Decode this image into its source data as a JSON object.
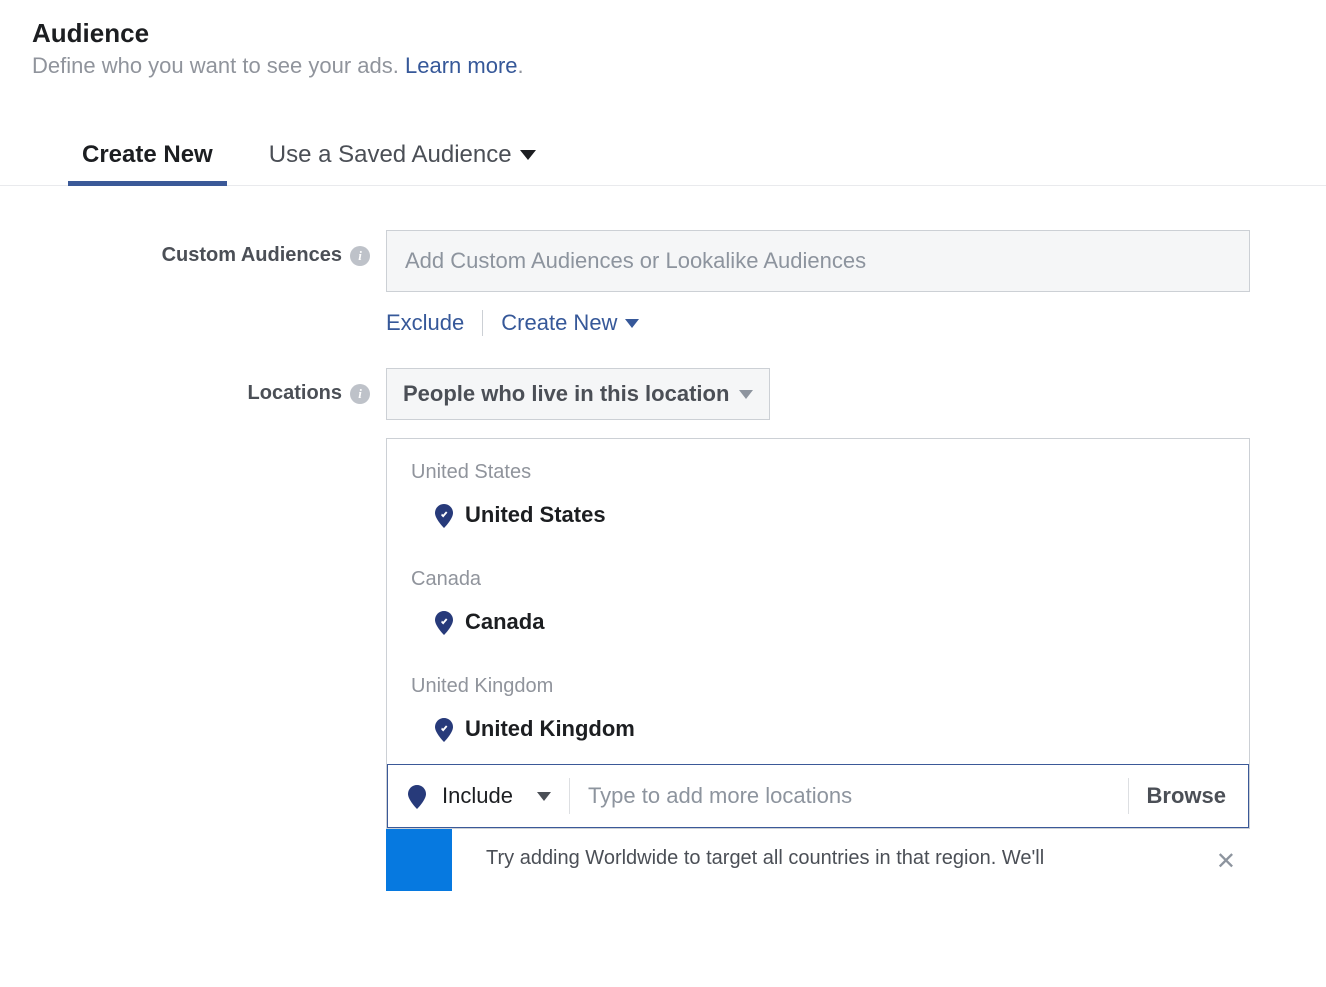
{
  "header": {
    "title": "Audience",
    "subtitle_prefix": "Define who you want to see your ads. ",
    "learn_more": "Learn more",
    "subtitle_suffix": "."
  },
  "tabs": {
    "create_new": "Create New",
    "use_saved": "Use a Saved Audience"
  },
  "custom_audiences": {
    "label": "Custom Audiences",
    "placeholder": "Add Custom Audiences or Lookalike Audiences",
    "exclude": "Exclude",
    "create_new": "Create New"
  },
  "locations": {
    "label": "Locations",
    "dropdown": "People who live in this location",
    "groups": [
      {
        "group": "United States",
        "item": "United States"
      },
      {
        "group": "Canada",
        "item": "Canada"
      },
      {
        "group": "United Kingdom",
        "item": "United Kingdom"
      }
    ],
    "include_label": "Include",
    "include_placeholder": "Type to add more locations",
    "browse": "Browse",
    "tip": "Try adding Worldwide to target all countries in that region. We'll"
  }
}
